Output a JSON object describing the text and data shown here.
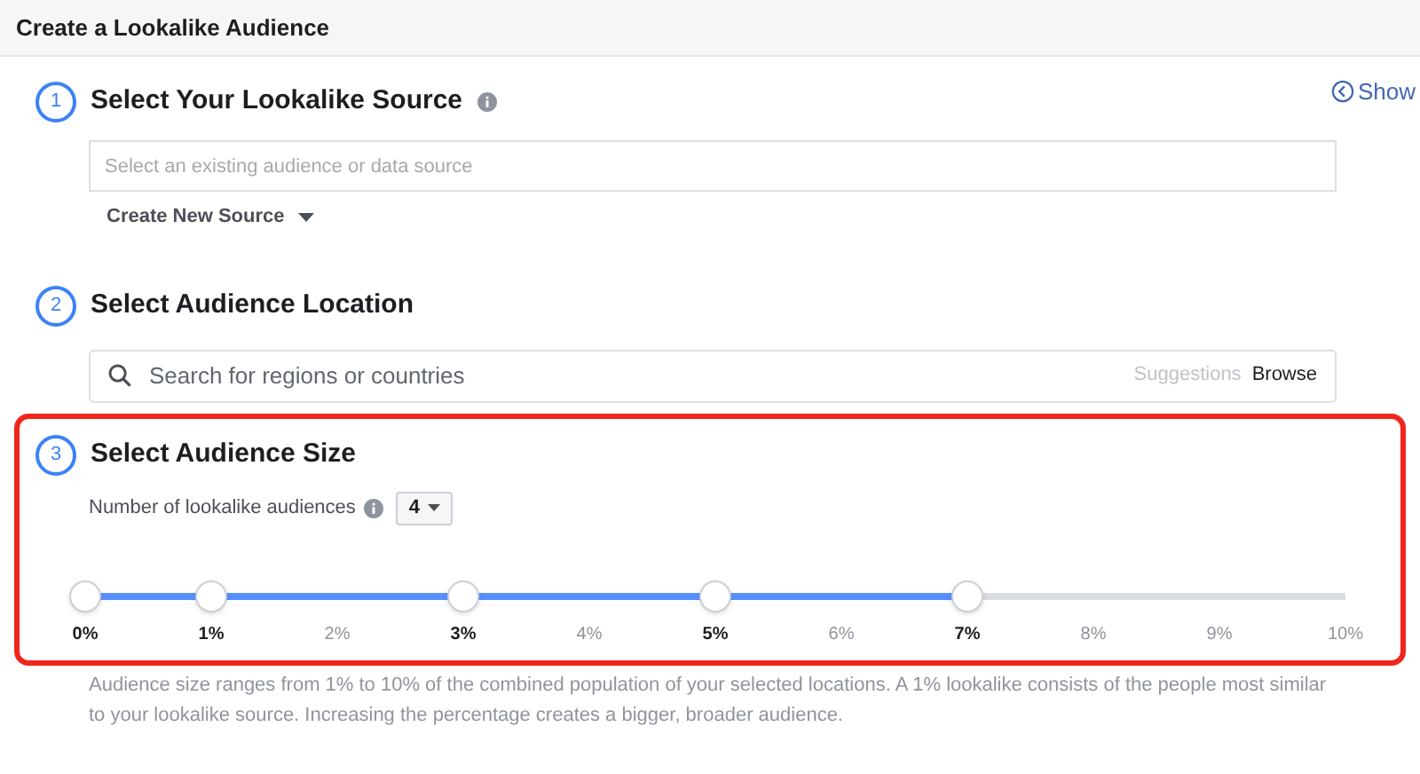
{
  "header": {
    "title": "Create a Lookalike Audience"
  },
  "show_link": {
    "label": "Show"
  },
  "steps": [
    {
      "number": "1",
      "title": "Select Your Lookalike Source",
      "info": true,
      "field": {
        "placeholder": "Select an existing audience or data source"
      },
      "create_source": {
        "label": "Create New Source"
      }
    },
    {
      "number": "2",
      "title": "Select Audience Location",
      "info": false,
      "search": {
        "placeholder": "Search for regions or countries",
        "suggestions": "Suggestions",
        "browse": "Browse"
      }
    },
    {
      "number": "3",
      "title": "Select Audience Size",
      "info": false,
      "highlighted": true,
      "count": {
        "label": "Number of lookalike audiences",
        "value": "4"
      },
      "slider": {
        "handles": [
          {
            "level": 0
          },
          {
            "level": 0.1
          },
          {
            "level": 0.3
          },
          {
            "level": 0.5
          },
          {
            "level": 0.7
          }
        ],
        "ticks": [
          {
            "label": "0%",
            "selected": true
          },
          {
            "label": "1%",
            "selected": true
          },
          {
            "label": "2%",
            "selected": false
          },
          {
            "label": "3%",
            "selected": true
          },
          {
            "label": "4%",
            "selected": false
          },
          {
            "label": "5%",
            "selected": true
          },
          {
            "label": "6%",
            "selected": false
          },
          {
            "label": "7%",
            "selected": true
          },
          {
            "label": "8%",
            "selected": false
          },
          {
            "label": "9%",
            "selected": false
          },
          {
            "label": "10%",
            "selected": false
          }
        ]
      }
    }
  ],
  "help_text": "Audience size ranges from 1% to 10% of the combined population of your selected locations. A 1% lookalike consists of the people most similar to your lookalike source. Increasing the percentage creates a bigger, broader audience."
}
